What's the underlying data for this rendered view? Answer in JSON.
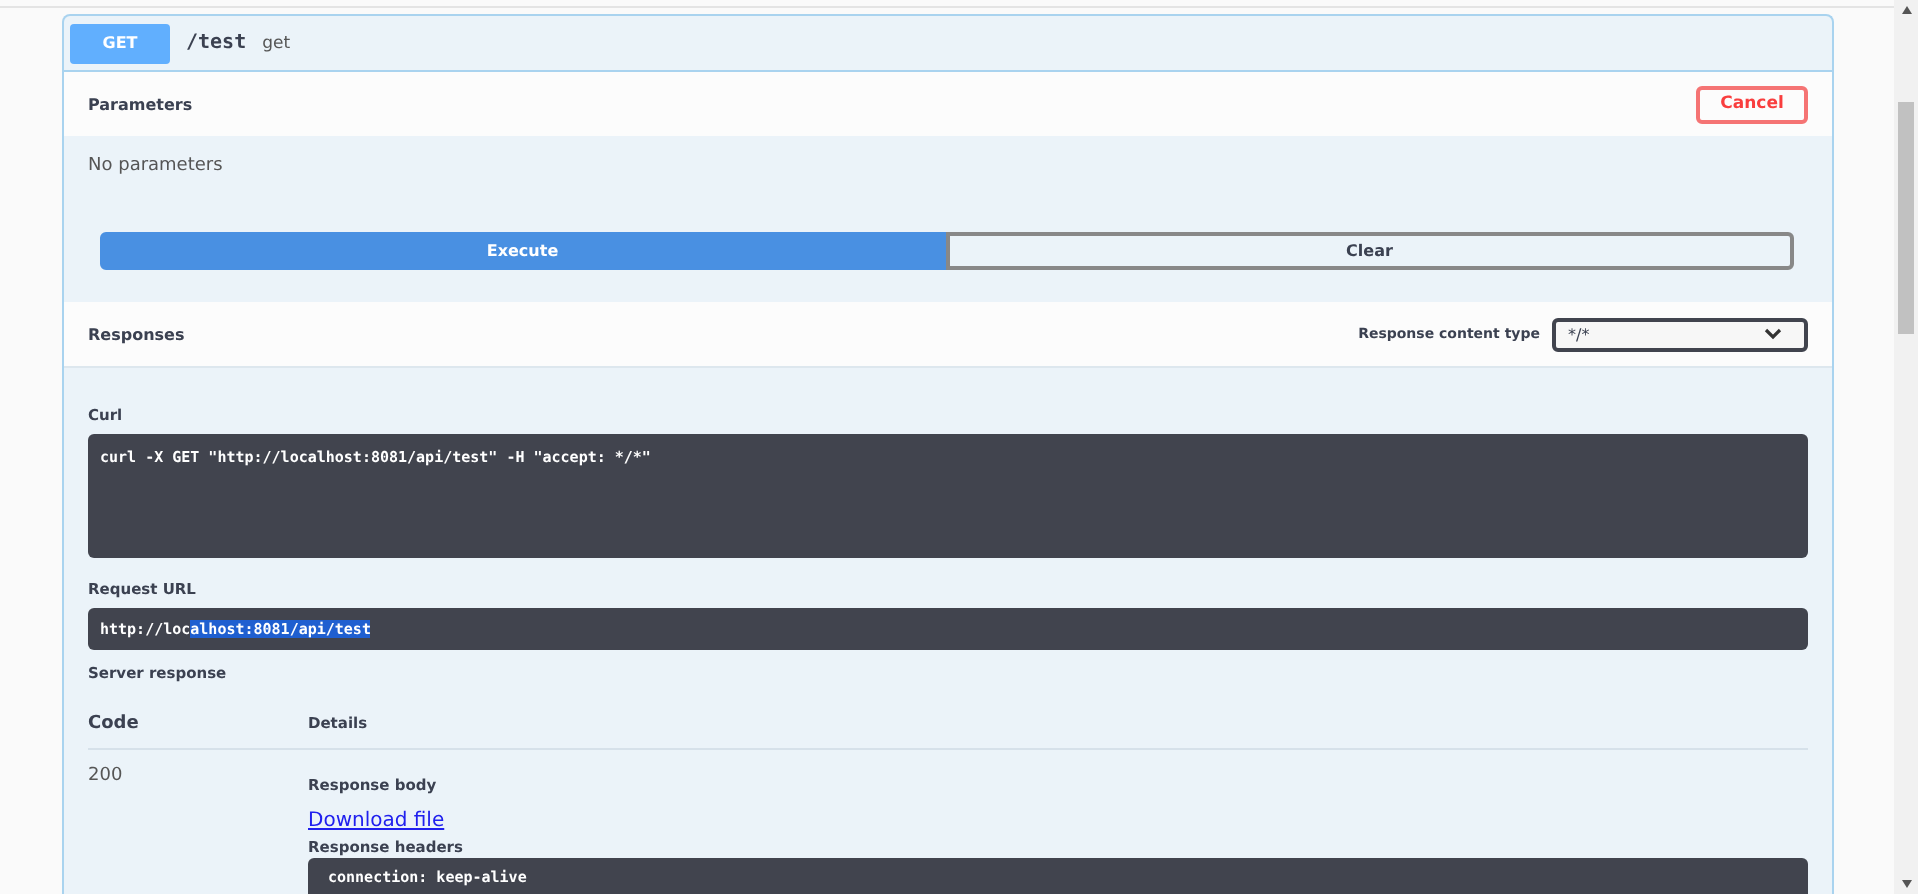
{
  "operation": {
    "method": "GET",
    "path": "/test",
    "summary": "get"
  },
  "parameters": {
    "title": "Parameters",
    "cancel_button": "Cancel",
    "message": "No parameters"
  },
  "actions": [
    {
      "label": "Execute",
      "kind": "primary"
    },
    {
      "label": "Clear",
      "kind": "secondary"
    }
  ],
  "responses": {
    "title": "Responses",
    "content_type_label": "Response content type",
    "content_type": "*/*"
  },
  "curl": {
    "label": "Curl",
    "command": "curl -X GET \"http://localhost:8081/api/test\" -H \"accept: */*\""
  },
  "request_url": {
    "label": "Request URL",
    "parts": [
      {
        "text": "http://loc",
        "selected": false
      },
      {
        "text": "alhost:8081/api/test",
        "selected": true
      }
    ]
  },
  "server_response": {
    "label": "Server response",
    "columns": [
      "Code",
      "Details"
    ],
    "code": "200",
    "body_label": "Response body",
    "download_link": "Download file",
    "headers_label": "Response headers",
    "headers_first_line": "connection: keep-alive"
  }
}
